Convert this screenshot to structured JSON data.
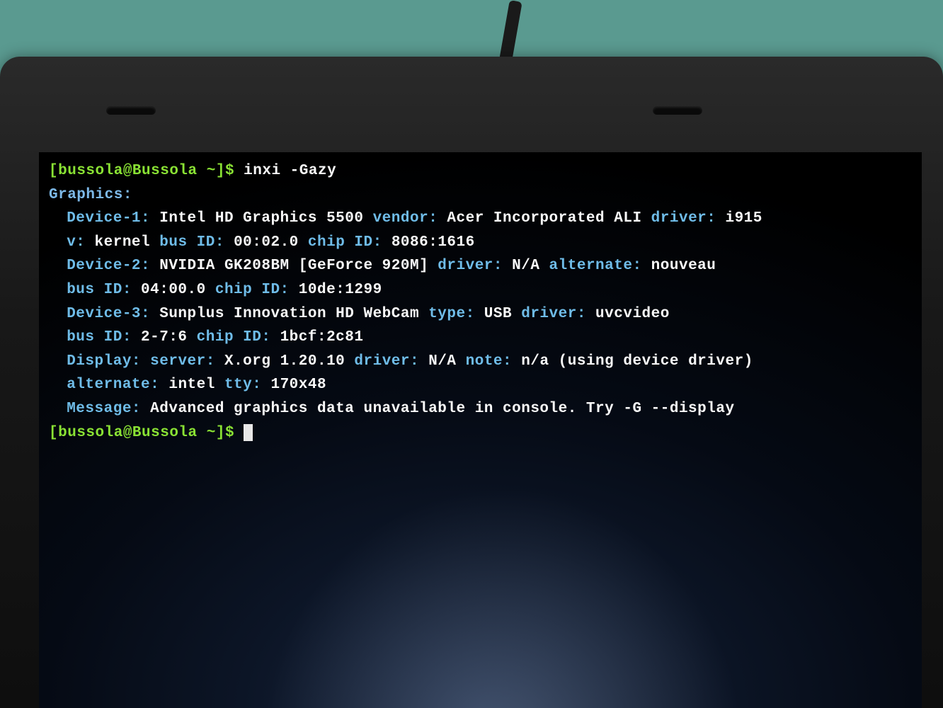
{
  "prompt": {
    "open": "[",
    "userhost": "bussola@Bussola",
    "path": " ~",
    "close": "]$ ",
    "command": "inxi -Gazy"
  },
  "header": "Graphics:",
  "dev1": {
    "label": "Device-1:",
    "name": " Intel HD Graphics 5500 ",
    "vendor_k": "vendor:",
    "vendor_v": " Acer Incorporated ALI ",
    "driver_k": "driver:",
    "driver_v": " i915",
    "v_k": "v:",
    "v_v": " kernel ",
    "busid_k": "bus ID:",
    "busid_v": " 00:02.0 ",
    "chipid_k": "chip ID:",
    "chipid_v": " 8086:1616"
  },
  "dev2": {
    "label": "Device-2:",
    "name": " NVIDIA GK208BM [GeForce 920M] ",
    "driver_k": "driver:",
    "driver_v": " N/A ",
    "alt_k": "alternate:",
    "alt_v": " nouveau",
    "busid_k": "bus ID:",
    "busid_v": " 04:00.0 ",
    "chipid_k": "chip ID:",
    "chipid_v": " 10de:1299"
  },
  "dev3": {
    "label": "Device-3:",
    "name": " Sunplus Innovation HD WebCam ",
    "type_k": "type:",
    "type_v": " USB ",
    "driver_k": "driver:",
    "driver_v": " uvcvideo",
    "busid_k": "bus ID:",
    "busid_v": " 2-7:6 ",
    "chipid_k": "chip ID:",
    "chipid_v": " 1bcf:2c81"
  },
  "display": {
    "label": "Display:",
    "server_k": " server:",
    "server_v": " X.org 1.20.10 ",
    "driver_k": "driver:",
    "driver_v": " N/A ",
    "note_k": "note:",
    "note_v": " n/a (using device driver)",
    "alt_k": "alternate:",
    "alt_v": " intel ",
    "tty_k": "tty:",
    "tty_v": " 170x48"
  },
  "message": {
    "label": "Message:",
    "text": " Advanced graphics data unavailable in console. Try -G --display"
  },
  "prompt2": {
    "open": "[",
    "userhost": "bussola@Bussola",
    "path": " ~",
    "close": "]$ "
  }
}
